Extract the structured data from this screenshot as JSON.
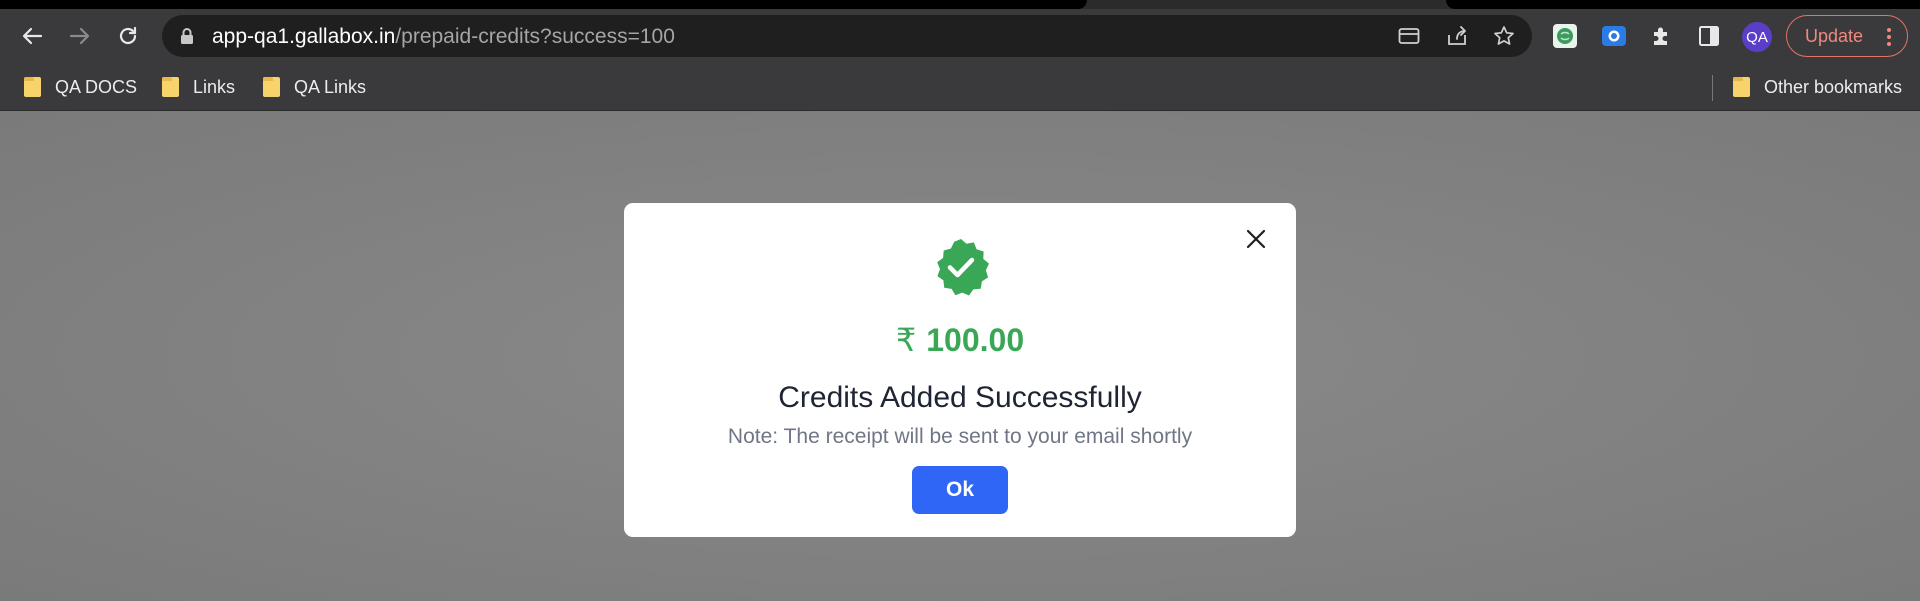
{
  "browser": {
    "url_host": "app-qa1.gallabox.in",
    "url_path": "/prepaid-credits?success=100",
    "profile_initials": "QA",
    "update_label": "Update",
    "accent_update": "#e2726a",
    "icons": {
      "back": "arrow-left-icon",
      "forward": "arrow-right-icon",
      "reload": "reload-icon",
      "lock": "lock-icon",
      "card": "card-icon",
      "share": "share-icon",
      "bookmark_star": "star-icon",
      "extensions": "puzzle-icon",
      "side_panel": "side-panel-icon"
    }
  },
  "bookmarks": {
    "items": [
      {
        "label": "QA DOCS"
      },
      {
        "label": "Links"
      },
      {
        "label": "QA Links"
      }
    ],
    "other_label": "Other bookmarks"
  },
  "modal": {
    "currency_symbol": "₹",
    "amount": "100.00",
    "title": "Credits Added Successfully",
    "note": "Note: The receipt will be sent to your email shortly",
    "ok_label": "Ok",
    "colors": {
      "success": "#3aa757",
      "primary_button": "#2f66f5"
    }
  }
}
